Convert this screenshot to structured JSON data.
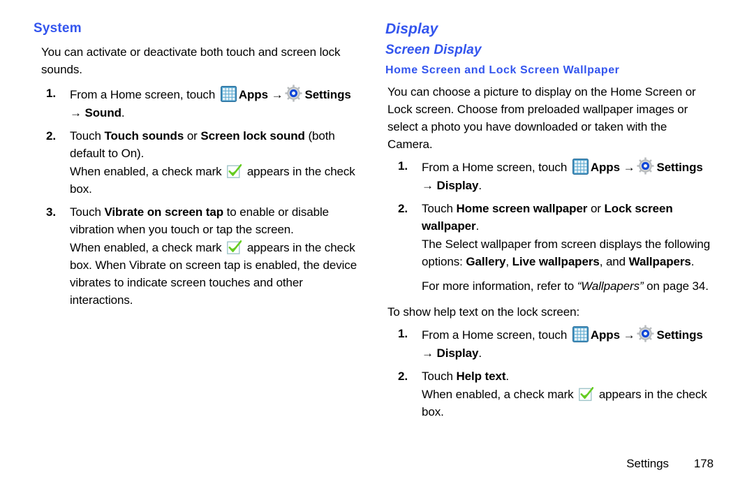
{
  "document": {
    "footer": {
      "section_label": "Settings",
      "page_number": "178"
    },
    "accent_color": "#3355ee"
  },
  "left_column": {
    "heading": "System",
    "intro": "You can activate or deactivate both touch and screen lock sounds.",
    "steps": [
      {
        "number": "1.",
        "text_parts": {
          "before_apps": "From a Home screen, touch ",
          "apps_label": "Apps",
          "arrow": "→",
          "settings_label": "Settings",
          "tail_arrow": "→",
          "tail_bold": "Sound",
          "tail_end": "."
        }
      },
      {
        "number": "2.",
        "lead": "Touch ",
        "bold_a": "Touch sounds",
        "mid": " or ",
        "bold_b": "Screen lock sound",
        "tail": " (both default to On).",
        "note_before": "When enabled, a check mark ",
        "note_after": " appears in the check box."
      },
      {
        "number": "3.",
        "lead": "Touch ",
        "bold_a": "Vibrate on screen tap",
        "tail": " to enable or disable vibration when you touch or tap the screen.",
        "note_before": "When enabled, a check mark ",
        "note_after": " appears in the check box. When Vibrate on screen tap is enabled, the device vibrates to indicate screen touches and other interactions."
      }
    ]
  },
  "right_column": {
    "chapter_heading": "Display",
    "sub_heading": "Screen Display",
    "sub_heading_2": "Home Screen and Lock Screen Wallpaper",
    "intro": "You can choose a picture to display on the Home Screen or Lock screen. Choose from preloaded wallpaper images or select a photo you have downloaded or taken with the Camera.",
    "steps": [
      {
        "number": "1.",
        "before_apps": "From a Home screen, touch ",
        "apps_label": "Apps",
        "arrow": "→",
        "settings_label": "Settings",
        "tail_arrow": "→",
        "tail_bold": "Display",
        "tail_end": "."
      },
      {
        "number": "2.",
        "lead": "Touch ",
        "bold_a": "Home screen wallpaper",
        "mid": " or ",
        "bold_b": "Lock screen wallpaper",
        "tail": ".",
        "note_1_before": "The Select wallpaper from screen displays the following options: ",
        "note_1_bold_a": "Gallery",
        "note_1_mid_a": ", ",
        "note_1_bold_b": "Live wallpapers",
        "note_1_mid_b": ", and ",
        "note_1_bold_c": "Wallpapers",
        "note_1_end": ".",
        "note_2_before": "For more information, refer to ",
        "note_2_italic": "“Wallpapers”",
        "note_2_after": " on page 34."
      }
    ],
    "lead_in_2": "To show help text on the lock screen:",
    "steps_2": [
      {
        "number": "1.",
        "before_apps": "From a Home screen, touch ",
        "apps_label": "Apps",
        "arrow": "→",
        "settings_label": "Settings",
        "tail_arrow": "→",
        "tail_bold": "Display",
        "tail_end": "."
      },
      {
        "number": "2.",
        "lead": "Touch ",
        "bold_a": "Help text",
        "tail": ".",
        "note_before": "When enabled, a check mark ",
        "note_after": " appears in the check box."
      }
    ]
  },
  "icons": {
    "apps": "apps-grid-icon",
    "settings": "settings-gear-icon",
    "checkbox": "checked-checkbox-icon"
  }
}
